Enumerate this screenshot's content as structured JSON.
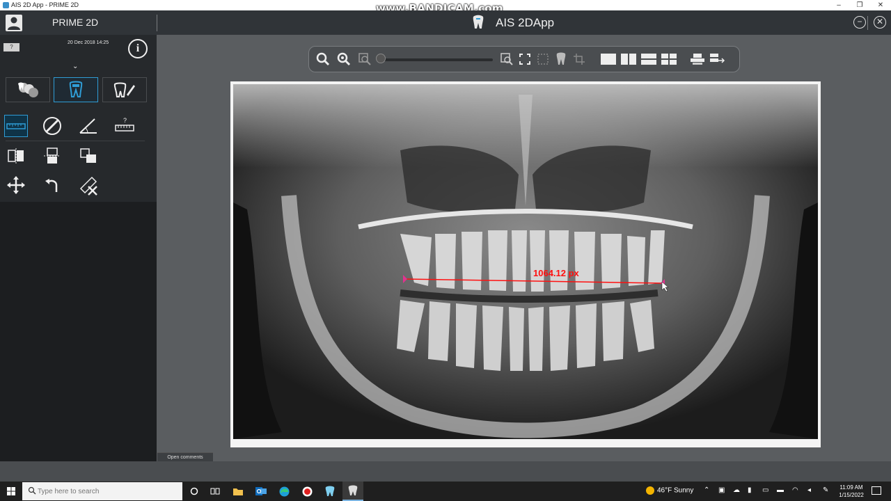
{
  "window": {
    "title": "AIS 2D App  -  PRIME 2D",
    "watermark": "www.BANDICAM.com",
    "controls": [
      "–",
      "❐",
      "✕"
    ]
  },
  "header": {
    "brand": "PRIME 2D",
    "app_title": "AIS 2DApp",
    "minimize_symbol": "−",
    "close_symbol": "✕"
  },
  "sidebar": {
    "version_badge": "?",
    "date": "20 Dec 2018 14:25",
    "info_symbol": "i",
    "expand_symbol": "⌄",
    "mode_tabs": [
      {
        "name": "teeth-group-icon",
        "active": false
      },
      {
        "name": "tooth-icon",
        "active": true
      },
      {
        "name": "tooth-pencil-icon",
        "active": false
      }
    ],
    "tools": [
      {
        "name": "ruler-measure-icon",
        "active": true
      },
      {
        "name": "protractor-icon",
        "active": false
      },
      {
        "name": "angle-measure-icon",
        "active": false
      },
      {
        "name": "calibrate-ruler-icon",
        "active": false
      },
      {
        "name": "flip-horizontal-icon",
        "active": false
      },
      {
        "name": "flip-vertical-icon",
        "active": false
      },
      {
        "name": "rotate-icon",
        "active": false
      },
      {
        "name": "move-icon",
        "active": false
      },
      {
        "name": "undo-icon",
        "active": false
      },
      {
        "name": "delete-measure-icon",
        "active": false
      }
    ]
  },
  "viewer": {
    "measurement_label": "1064.12 px",
    "measurement_color": "#ff1010",
    "accent_color": "#2f9dd6",
    "open_comments": "Open comments"
  },
  "taskbar": {
    "search_placeholder": "Type here to search",
    "weather": "46°F  Sunny",
    "time": "11:09 AM",
    "date": "1/15/2022"
  }
}
